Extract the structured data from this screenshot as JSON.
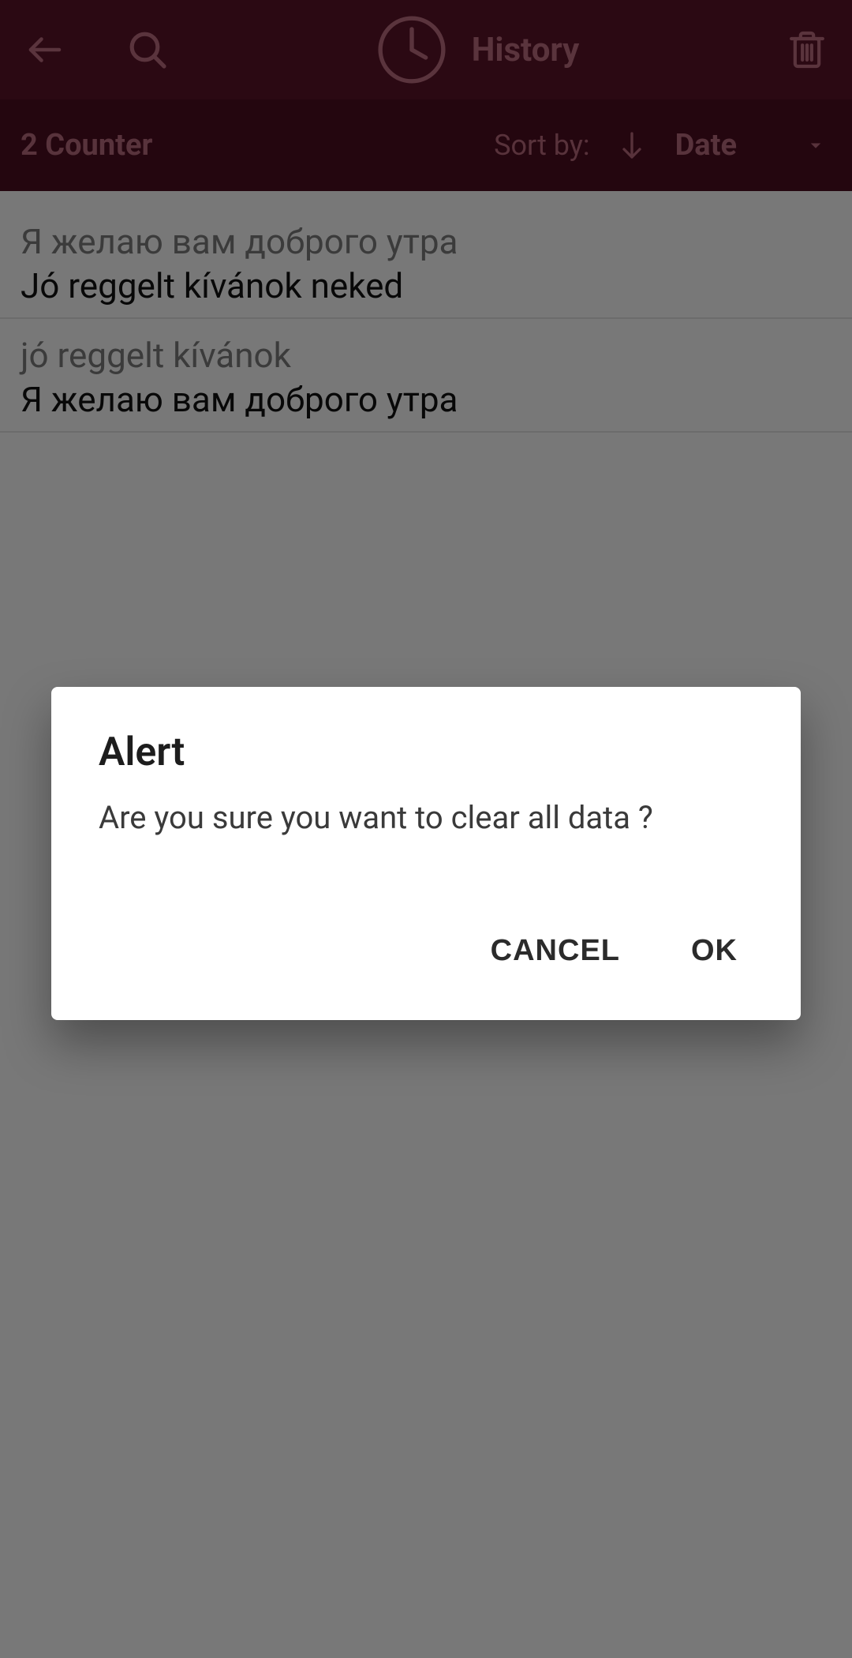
{
  "appbar": {
    "title": "History"
  },
  "subbar": {
    "counter": "2 Counter",
    "sort_label": "Sort by:",
    "sort_value": "Date"
  },
  "history": [
    {
      "source": "Я желаю вам доброго утра",
      "target": "Jó reggelt kívánok neked"
    },
    {
      "source": "jó reggelt kívánok",
      "target": "Я желаю вам доброго утра"
    }
  ],
  "dialog": {
    "title": "Alert",
    "message": "Are you sure you want to clear all data ?",
    "cancel": "CANCEL",
    "ok": "OK"
  }
}
